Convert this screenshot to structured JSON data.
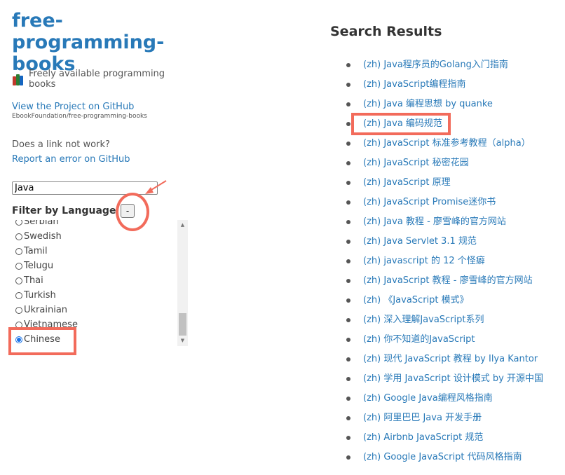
{
  "site": {
    "title_line1": "free-programming-",
    "title_line2": "books",
    "tagline": "Freely available programming books",
    "github_link": "View the Project on GitHub",
    "github_repo": "EbookFoundation/free-programming-books",
    "broken_question": "Does a link not work?",
    "report_link": "Report an error on GitHub"
  },
  "search": {
    "value": "Java"
  },
  "filter": {
    "heading": "Filter by Language",
    "toggle_label": "-",
    "languages": [
      {
        "label": "Serbian",
        "checked": false
      },
      {
        "label": "Swedish",
        "checked": false
      },
      {
        "label": "Tamil",
        "checked": false
      },
      {
        "label": "Telugu",
        "checked": false
      },
      {
        "label": "Thai",
        "checked": false
      },
      {
        "label": "Turkish",
        "checked": false
      },
      {
        "label": "Ukrainian",
        "checked": false
      },
      {
        "label": "Vietnamese",
        "checked": false
      },
      {
        "label": "Chinese",
        "checked": true
      }
    ]
  },
  "results": {
    "heading": "Search Results",
    "items": [
      "(zh) Java程序员的Golang入门指南",
      "(zh) JavaScript编程指南",
      "(zh) Java 编程思想 by quanke",
      "(zh) Java 编码规范",
      "(zh) JavaScript 标准参考教程（alpha）",
      "(zh) JavaScript 秘密花园",
      "(zh) JavaScript 原理",
      "(zh) JavaScript Promise迷你书",
      "(zh) Java 教程 - 廖雪峰的官方网站",
      "(zh) Java Servlet 3.1 规范",
      "(zh) javascript 的 12 个怪癖",
      "(zh) JavaScript 教程 - 廖雪峰的官方网站",
      "(zh) 《JavaScript 模式》",
      "(zh) 深入理解JavaScript系列",
      "(zh) 你不知道的JavaScript",
      "(zh) 现代 JavaScript 教程 by Ilya Kantor",
      "(zh) 学用 JavaScript 设计模式 by 开源中国",
      "(zh) Google Java编程风格指南",
      "(zh) 阿里巴巴 Java 开发手册",
      "(zh) Airbnb JavaScript 规范",
      "(zh) Google JavaScript 代码风格指南"
    ]
  },
  "colors": {
    "link": "#2879b8",
    "annotation": "#f26b5b",
    "radio_checked": "#1a73e8"
  },
  "icons": {
    "tagline_icon": "books-icon",
    "scroll_up": "triangle-up-icon",
    "scroll_down": "triangle-down-icon"
  }
}
